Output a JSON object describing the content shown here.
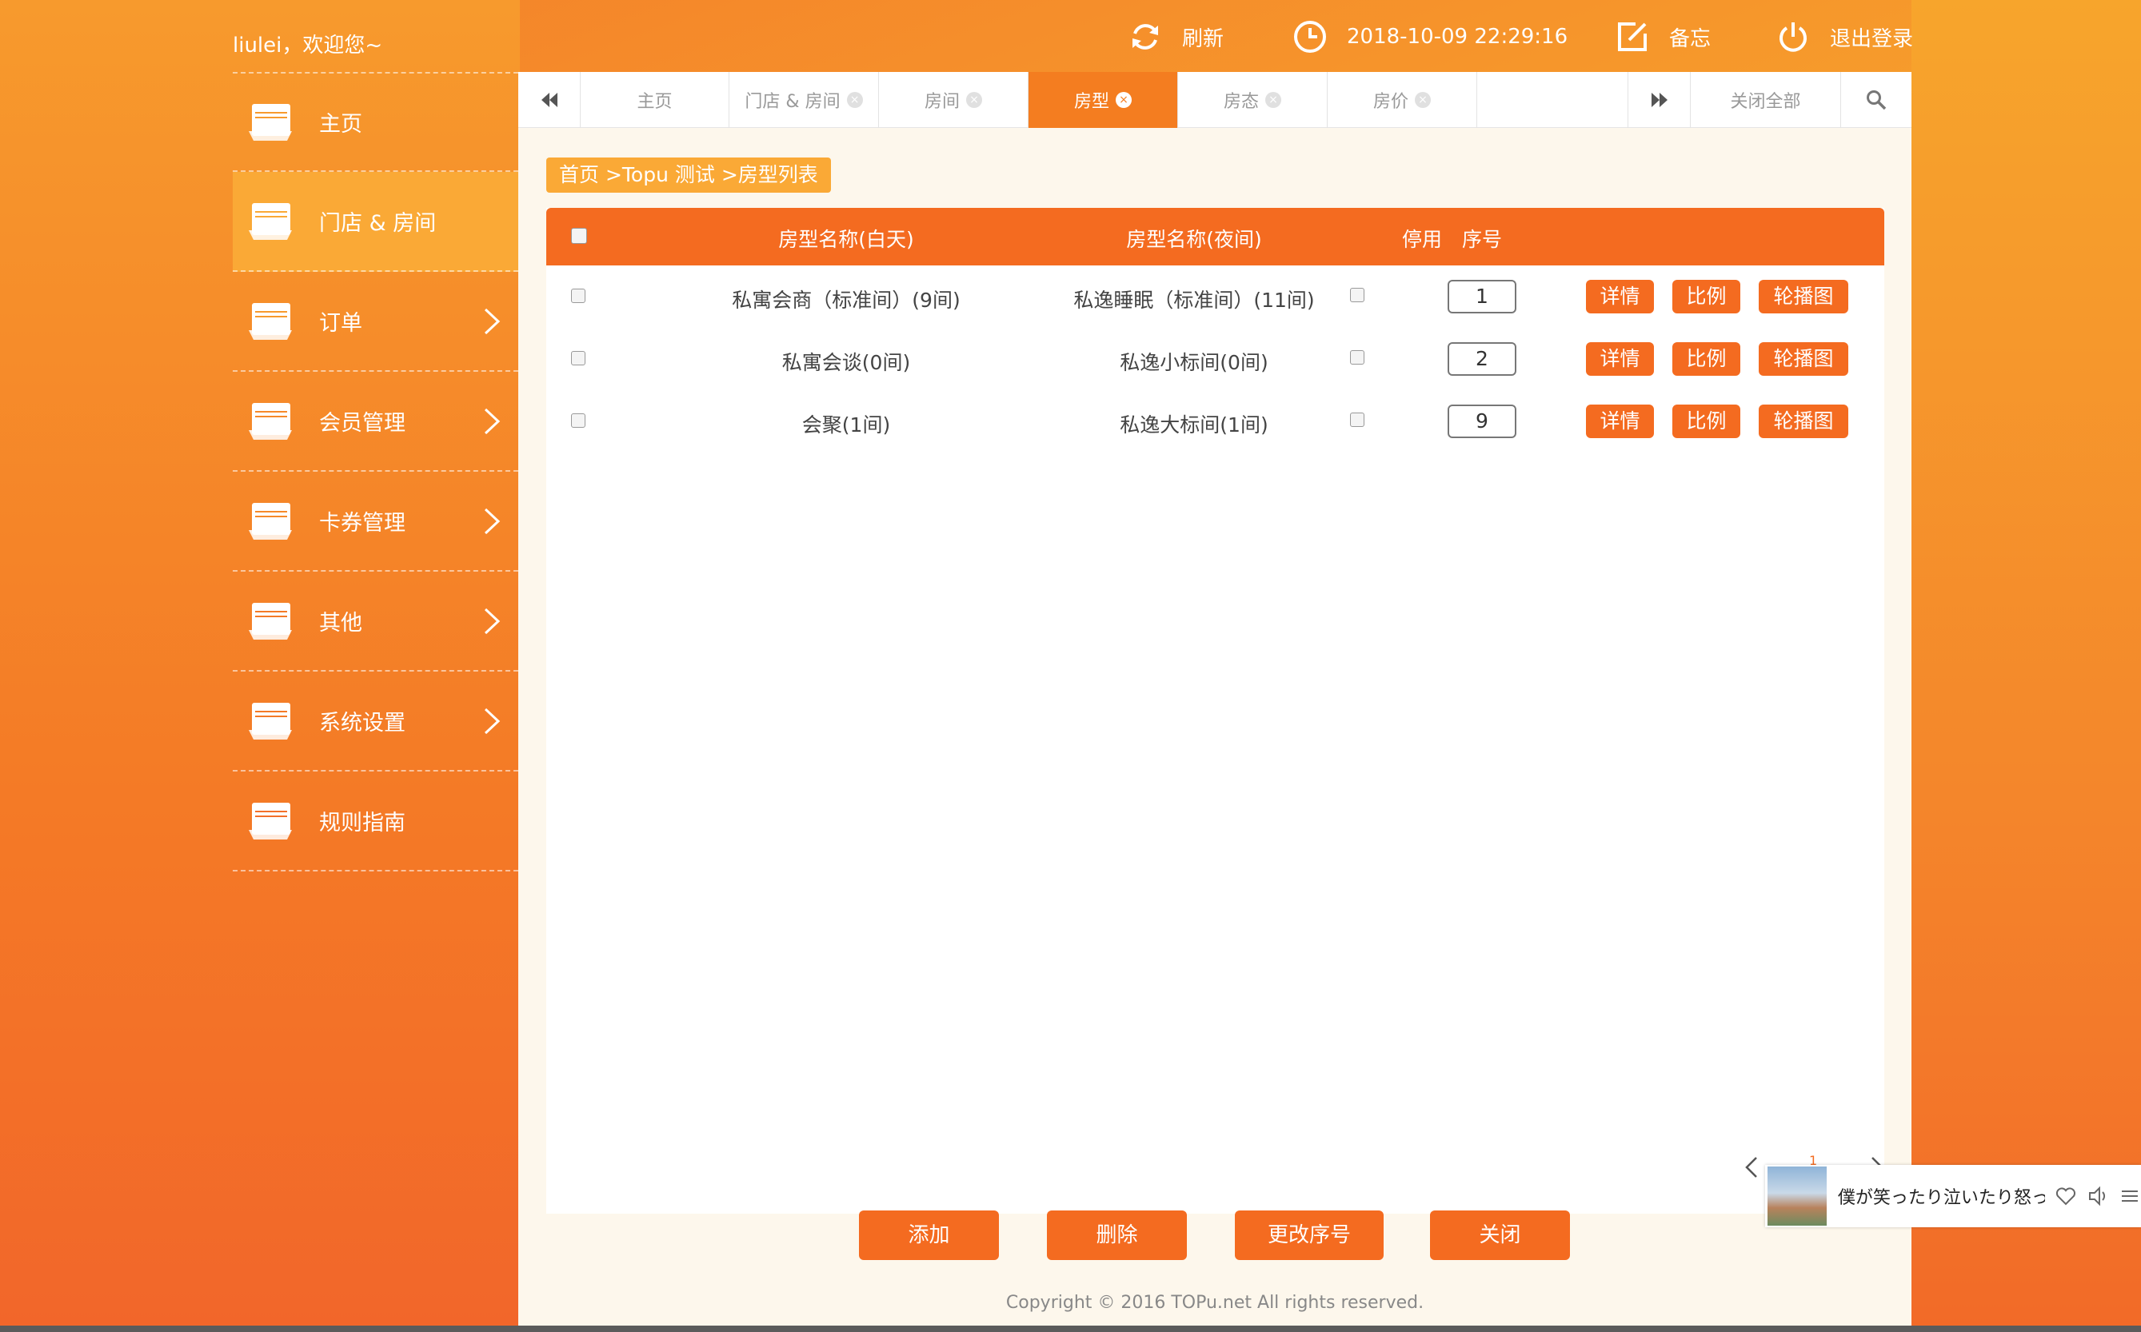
{
  "header": {
    "welcome": "liulei，欢迎您~",
    "refresh_label": "刷新",
    "datetime": "2018-10-09 22:29:16",
    "memo_label": "备忘",
    "logout_label": "退出登录"
  },
  "sidebar": {
    "items": [
      {
        "label": "主页",
        "has_arrow": false
      },
      {
        "label": "门店 & 房间",
        "has_arrow": false,
        "active": true
      },
      {
        "label": "订单",
        "has_arrow": true
      },
      {
        "label": "会员管理",
        "has_arrow": true
      },
      {
        "label": "卡券管理",
        "has_arrow": true
      },
      {
        "label": "其他",
        "has_arrow": true
      },
      {
        "label": "系统设置",
        "has_arrow": true
      },
      {
        "label": "规则指南",
        "has_arrow": false
      }
    ]
  },
  "tabs": {
    "items": [
      {
        "label": "主页",
        "closable": false
      },
      {
        "label": "门店 & 房间",
        "closable": true
      },
      {
        "label": "房间",
        "closable": true
      },
      {
        "label": "房型",
        "closable": true,
        "active": true
      },
      {
        "label": "房态",
        "closable": true
      },
      {
        "label": "房价",
        "closable": true
      }
    ],
    "close_all_label": "关闭全部"
  },
  "breadcrumb": "首页 >Topu 测试 >房型列表",
  "table": {
    "columns": {
      "day_name": "房型名称(白天)",
      "night_name": "房型名称(夜间)",
      "disabled": "停用",
      "seq": "序号"
    },
    "rows": [
      {
        "day_name": "私寓会商（标准间）(9间)",
        "night_name": "私逸睡眠（标准间）(11间)",
        "seq": "1"
      },
      {
        "day_name": "私寓会谈(0间)",
        "night_name": "私逸小标间(0间)",
        "seq": "2"
      },
      {
        "day_name": "会聚(1间)",
        "night_name": "私逸大标间(1间)",
        "seq": "9"
      }
    ],
    "row_buttons": {
      "detail": "详情",
      "ratio": "比例",
      "carousel": "轮播图"
    }
  },
  "pager": {
    "current": "1"
  },
  "bottom_buttons": {
    "add": "添加",
    "delete": "删除",
    "change_seq": "更改序号",
    "close": "关闭"
  },
  "copyright": "Copyright © 2016 TOPu.net All rights reserved.",
  "music": {
    "title": "僕が笑ったり泣いたり怒っ"
  },
  "colors": {
    "accent": "#f46b20",
    "sidebar_active": "#faa936",
    "panel_bg": "#fdf7ec"
  }
}
